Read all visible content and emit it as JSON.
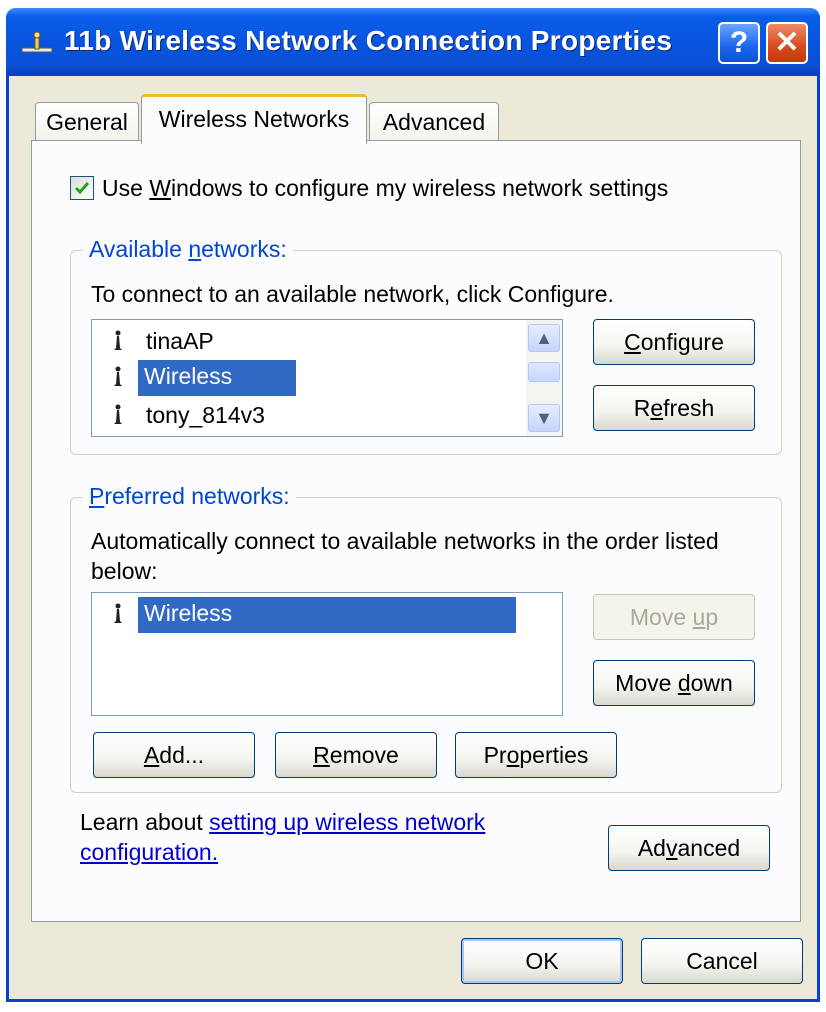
{
  "window": {
    "title": "11b Wireless Network Connection Properties",
    "help_label": "?",
    "close_label": "✕"
  },
  "tabs": [
    {
      "label": "General",
      "active": false
    },
    {
      "label": "Wireless Networks",
      "active": true
    },
    {
      "label": "Advanced",
      "active": false
    }
  ],
  "use_windows": {
    "checked": true,
    "label_before": "Use ",
    "label_accel": "W",
    "label_after": "indows to configure my wireless network settings"
  },
  "available": {
    "legend_before": "Available ",
    "legend_accel": "n",
    "legend_after": "etworks:",
    "instruction": "To connect to an available network, click Configure.",
    "networks": [
      "tinaAP",
      "Wireless",
      "tony_814v3"
    ],
    "selected_index": 1,
    "configure_accel": "C",
    "configure_rest": "onfigure",
    "refresh_before": "R",
    "refresh_accel": "e",
    "refresh_after": "fresh"
  },
  "preferred": {
    "legend_accel": "P",
    "legend_rest": "referred networks:",
    "instruction_line1": "Automatically connect to available networks in the order listed",
    "instruction_line2": "below:",
    "networks": [
      "Wireless"
    ],
    "move_up_before": "Move ",
    "move_up_accel": "u",
    "move_up_after": "p",
    "move_down_before": "Move ",
    "move_down_accel": "d",
    "move_down_after": "own",
    "add_accel": "A",
    "add_rest": "dd...",
    "remove_accel": "R",
    "remove_rest": "emove",
    "properties_before": "Pr",
    "properties_accel": "o",
    "properties_after": "perties"
  },
  "learn": {
    "prefix": "Learn about ",
    "link_line1": "setting up wireless network",
    "link_line2": "configuration."
  },
  "advanced_before": "Ad",
  "advanced_accel": "v",
  "advanced_after": "anced",
  "footer": {
    "ok_label": "OK",
    "cancel_label": "Cancel"
  }
}
